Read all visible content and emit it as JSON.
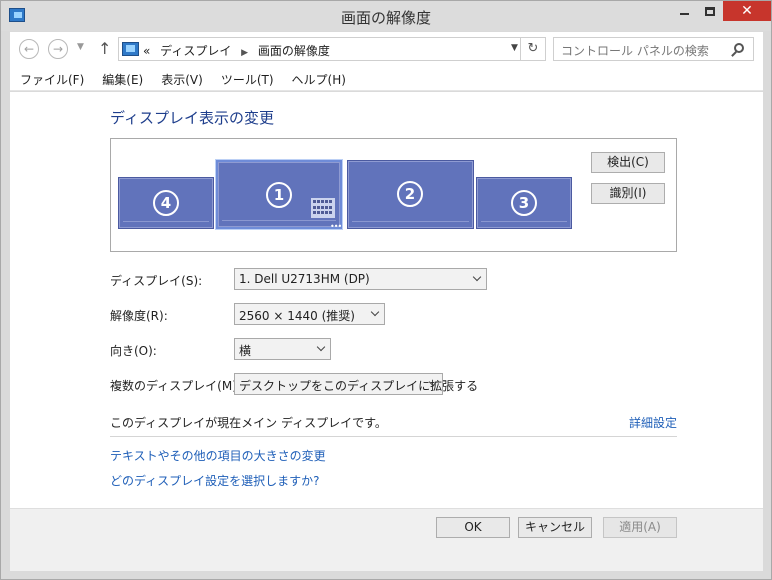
{
  "window": {
    "title": "画面の解像度",
    "close_glyph": "✕"
  },
  "nav": {
    "back_glyph": "←",
    "forward_glyph": "→",
    "recent_glyph": "▼",
    "up_glyph": "↑",
    "breadcrumb_overflow": "«",
    "breadcrumb": [
      "ディスプレイ",
      "画面の解像度"
    ],
    "breadcrumb_sep": "▶",
    "address_dropdown_glyph": "▼",
    "refresh_glyph": "↻",
    "search_placeholder": "コントロール パネルの検索"
  },
  "menu": [
    "ファイル(F)",
    "編集(E)",
    "表示(V)",
    "ツール(T)",
    "ヘルプ(H)"
  ],
  "main": {
    "heading": "ディスプレイ表示の変更",
    "monitors": [
      {
        "id": "4",
        "label": "4"
      },
      {
        "id": "1",
        "label": "1",
        "selected": true
      },
      {
        "id": "2",
        "label": "2"
      },
      {
        "id": "3",
        "label": "3"
      }
    ],
    "dots_glyph": "•••",
    "detect_button": "検出(C)",
    "identify_button": "識別(I)",
    "display_label": "ディスプレイ(S):",
    "display_value": "1. Dell U2713HM (DP)",
    "resolution_label": "解像度(R):",
    "resolution_value": "2560 × 1440 (推奨)",
    "orientation_label": "向き(O):",
    "orientation_value": "横",
    "multi_label": "複数のディスプレイ(M):",
    "multi_value": "デスクトップをこのディスプレイに拡張する",
    "status_text": "このディスプレイが現在メイン ディスプレイです。",
    "advanced_link": "詳細設定",
    "text_size_link": "テキストやその他の項目の大きさの変更",
    "which_settings_link": "どのディスプレイ設定を選択しますか?"
  },
  "footer": {
    "ok": "OK",
    "cancel": "キャンセル",
    "apply": "適用(A)"
  },
  "colors": {
    "monitor_fill": "#6173bb",
    "link": "#1f5fb8",
    "heading": "#1e3e8c",
    "close": "#c7352c"
  }
}
